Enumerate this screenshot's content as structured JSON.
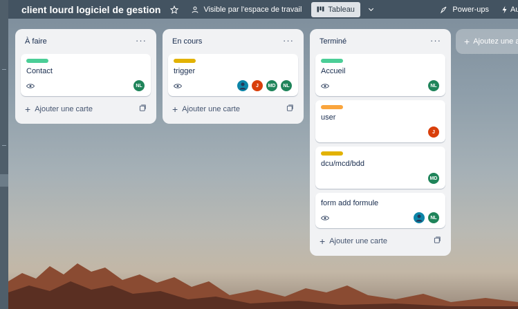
{
  "board": {
    "title": "client lourd logiciel de gestion",
    "visibility": "Visible par l'espace de travail",
    "view_label": "Tableau",
    "powerups_label": "Power-ups",
    "automation_label": "Au"
  },
  "lists": [
    {
      "title": "À faire",
      "menu": "···",
      "add_label": "Ajouter une carte",
      "cards": [
        {
          "label_color": "#4bce97",
          "title": "Contact",
          "watch": true,
          "avatars": [
            {
              "initials": "NL",
              "color": "#1f845a"
            }
          ]
        }
      ]
    },
    {
      "title": "En cours",
      "menu": "···",
      "add_label": "Ajouter une carte",
      "cards": [
        {
          "label_color": "#e2b203",
          "title": "trigger",
          "watch": true,
          "avatars": [
            {
              "initials": "",
              "color": "#0c85a8"
            },
            {
              "initials": "J",
              "color": "#d93f0b"
            },
            {
              "initials": "MD",
              "color": "#1f845a"
            },
            {
              "initials": "NL",
              "color": "#1f845a"
            }
          ]
        }
      ]
    },
    {
      "title": "Terminé",
      "menu": "···",
      "add_label": "Ajouter une carte",
      "cards": [
        {
          "label_color": "#4bce97",
          "title": "Accueil",
          "watch": true,
          "avatars": [
            {
              "initials": "NL",
              "color": "#1f845a"
            }
          ]
        },
        {
          "label_color": "#faa53d",
          "title": "user",
          "watch": false,
          "avatars": [
            {
              "initials": "J",
              "color": "#d93f0b"
            }
          ]
        },
        {
          "label_color": "#e2b203",
          "title": "dcu/mcd/bdd",
          "watch": false,
          "avatars": [
            {
              "initials": "MD",
              "color": "#1f845a"
            }
          ]
        },
        {
          "label_color": "",
          "title": "form add formule",
          "watch": true,
          "avatars": [
            {
              "initials": "",
              "color": "#0c85a8"
            },
            {
              "initials": "NL",
              "color": "#1f845a"
            }
          ]
        }
      ]
    }
  ],
  "add_list_label": "Ajoutez une a"
}
